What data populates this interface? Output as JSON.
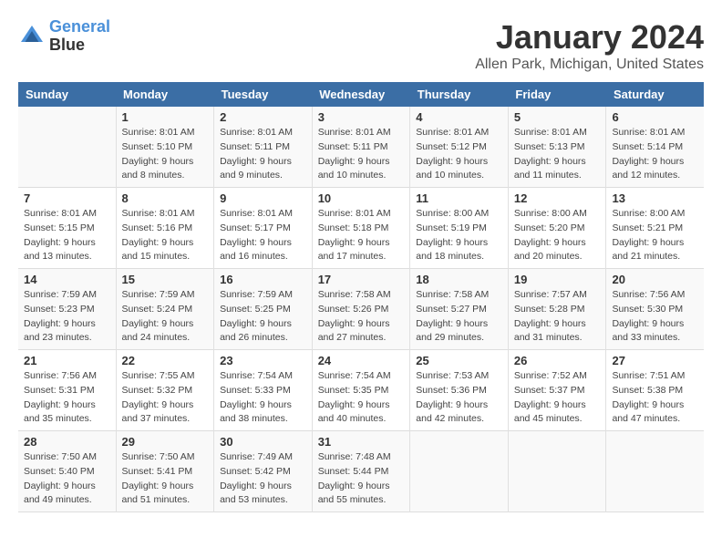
{
  "header": {
    "logo_line1": "General",
    "logo_line2": "Blue",
    "title": "January 2024",
    "subtitle": "Allen Park, Michigan, United States"
  },
  "days_of_week": [
    "Sunday",
    "Monday",
    "Tuesday",
    "Wednesday",
    "Thursday",
    "Friday",
    "Saturday"
  ],
  "weeks": [
    [
      {
        "num": "",
        "info": ""
      },
      {
        "num": "1",
        "info": "Sunrise: 8:01 AM\nSunset: 5:10 PM\nDaylight: 9 hours\nand 8 minutes."
      },
      {
        "num": "2",
        "info": "Sunrise: 8:01 AM\nSunset: 5:11 PM\nDaylight: 9 hours\nand 9 minutes."
      },
      {
        "num": "3",
        "info": "Sunrise: 8:01 AM\nSunset: 5:11 PM\nDaylight: 9 hours\nand 10 minutes."
      },
      {
        "num": "4",
        "info": "Sunrise: 8:01 AM\nSunset: 5:12 PM\nDaylight: 9 hours\nand 10 minutes."
      },
      {
        "num": "5",
        "info": "Sunrise: 8:01 AM\nSunset: 5:13 PM\nDaylight: 9 hours\nand 11 minutes."
      },
      {
        "num": "6",
        "info": "Sunrise: 8:01 AM\nSunset: 5:14 PM\nDaylight: 9 hours\nand 12 minutes."
      }
    ],
    [
      {
        "num": "7",
        "info": "Sunrise: 8:01 AM\nSunset: 5:15 PM\nDaylight: 9 hours\nand 13 minutes."
      },
      {
        "num": "8",
        "info": "Sunrise: 8:01 AM\nSunset: 5:16 PM\nDaylight: 9 hours\nand 15 minutes."
      },
      {
        "num": "9",
        "info": "Sunrise: 8:01 AM\nSunset: 5:17 PM\nDaylight: 9 hours\nand 16 minutes."
      },
      {
        "num": "10",
        "info": "Sunrise: 8:01 AM\nSunset: 5:18 PM\nDaylight: 9 hours\nand 17 minutes."
      },
      {
        "num": "11",
        "info": "Sunrise: 8:00 AM\nSunset: 5:19 PM\nDaylight: 9 hours\nand 18 minutes."
      },
      {
        "num": "12",
        "info": "Sunrise: 8:00 AM\nSunset: 5:20 PM\nDaylight: 9 hours\nand 20 minutes."
      },
      {
        "num": "13",
        "info": "Sunrise: 8:00 AM\nSunset: 5:21 PM\nDaylight: 9 hours\nand 21 minutes."
      }
    ],
    [
      {
        "num": "14",
        "info": "Sunrise: 7:59 AM\nSunset: 5:23 PM\nDaylight: 9 hours\nand 23 minutes."
      },
      {
        "num": "15",
        "info": "Sunrise: 7:59 AM\nSunset: 5:24 PM\nDaylight: 9 hours\nand 24 minutes."
      },
      {
        "num": "16",
        "info": "Sunrise: 7:59 AM\nSunset: 5:25 PM\nDaylight: 9 hours\nand 26 minutes."
      },
      {
        "num": "17",
        "info": "Sunrise: 7:58 AM\nSunset: 5:26 PM\nDaylight: 9 hours\nand 27 minutes."
      },
      {
        "num": "18",
        "info": "Sunrise: 7:58 AM\nSunset: 5:27 PM\nDaylight: 9 hours\nand 29 minutes."
      },
      {
        "num": "19",
        "info": "Sunrise: 7:57 AM\nSunset: 5:28 PM\nDaylight: 9 hours\nand 31 minutes."
      },
      {
        "num": "20",
        "info": "Sunrise: 7:56 AM\nSunset: 5:30 PM\nDaylight: 9 hours\nand 33 minutes."
      }
    ],
    [
      {
        "num": "21",
        "info": "Sunrise: 7:56 AM\nSunset: 5:31 PM\nDaylight: 9 hours\nand 35 minutes."
      },
      {
        "num": "22",
        "info": "Sunrise: 7:55 AM\nSunset: 5:32 PM\nDaylight: 9 hours\nand 37 minutes."
      },
      {
        "num": "23",
        "info": "Sunrise: 7:54 AM\nSunset: 5:33 PM\nDaylight: 9 hours\nand 38 minutes."
      },
      {
        "num": "24",
        "info": "Sunrise: 7:54 AM\nSunset: 5:35 PM\nDaylight: 9 hours\nand 40 minutes."
      },
      {
        "num": "25",
        "info": "Sunrise: 7:53 AM\nSunset: 5:36 PM\nDaylight: 9 hours\nand 42 minutes."
      },
      {
        "num": "26",
        "info": "Sunrise: 7:52 AM\nSunset: 5:37 PM\nDaylight: 9 hours\nand 45 minutes."
      },
      {
        "num": "27",
        "info": "Sunrise: 7:51 AM\nSunset: 5:38 PM\nDaylight: 9 hours\nand 47 minutes."
      }
    ],
    [
      {
        "num": "28",
        "info": "Sunrise: 7:50 AM\nSunset: 5:40 PM\nDaylight: 9 hours\nand 49 minutes."
      },
      {
        "num": "29",
        "info": "Sunrise: 7:50 AM\nSunset: 5:41 PM\nDaylight: 9 hours\nand 51 minutes."
      },
      {
        "num": "30",
        "info": "Sunrise: 7:49 AM\nSunset: 5:42 PM\nDaylight: 9 hours\nand 53 minutes."
      },
      {
        "num": "31",
        "info": "Sunrise: 7:48 AM\nSunset: 5:44 PM\nDaylight: 9 hours\nand 55 minutes."
      },
      {
        "num": "",
        "info": ""
      },
      {
        "num": "",
        "info": ""
      },
      {
        "num": "",
        "info": ""
      }
    ]
  ]
}
